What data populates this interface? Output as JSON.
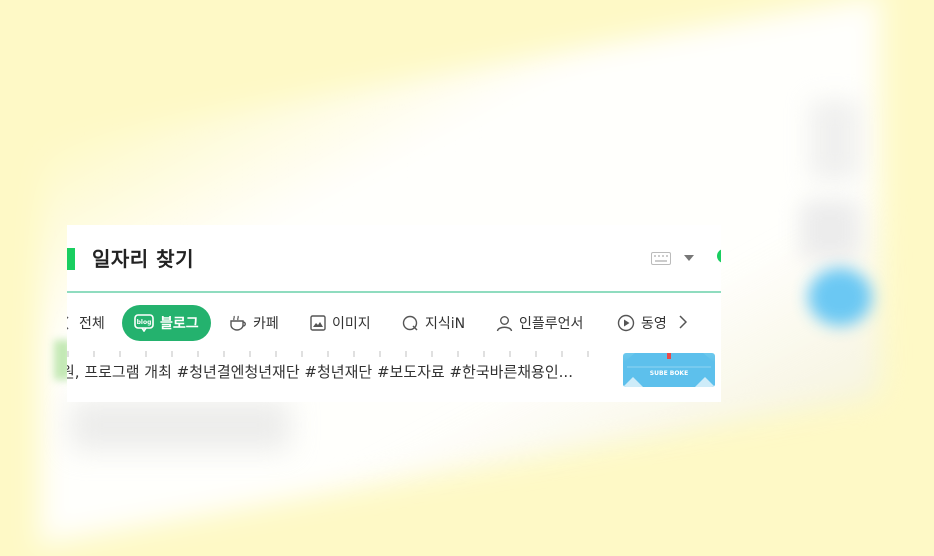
{
  "search": {
    "query": "일자리 찾기"
  },
  "tabs": [
    {
      "label": "전체",
      "icon": "chevron-left-icon"
    },
    {
      "label": "블로그",
      "icon": "blog-icon",
      "active": true
    },
    {
      "label": "카페",
      "icon": "cafe-icon"
    },
    {
      "label": "이미지",
      "icon": "image-icon"
    },
    {
      "label": "지식iN",
      "icon": "knowledge-icon"
    },
    {
      "label": "인플루언서",
      "icon": "influencer-icon"
    },
    {
      "label": "동영",
      "icon": "video-icon"
    }
  ],
  "result": {
    "snippet": "원, 프로그램 개최 #청년결엔청년재단 #청년재단 #보도자료 #한국바른채용인...",
    "thumbnail_text": "SUBE BOKE"
  },
  "colors": {
    "accent": "#19ce60",
    "active_tab": "#24b26e",
    "background": "#fef9c6"
  }
}
